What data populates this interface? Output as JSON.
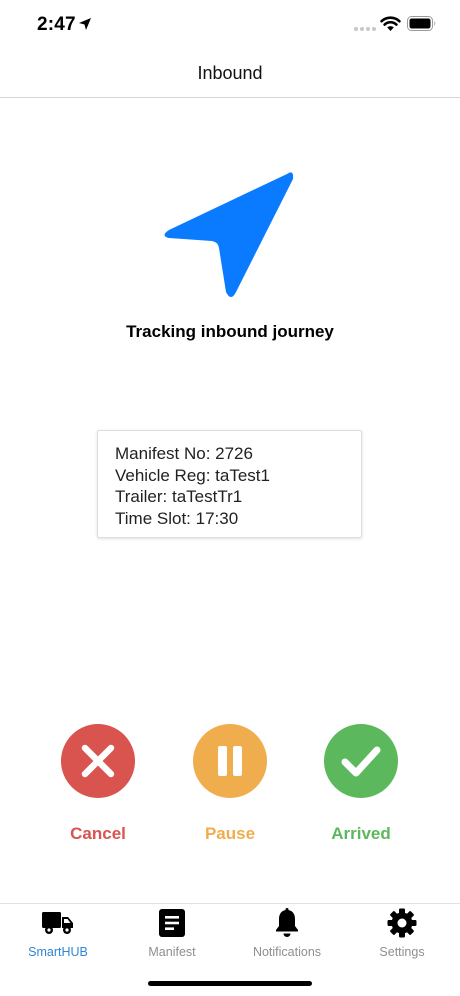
{
  "status_bar": {
    "time": "2:47",
    "icons": [
      "location-arrow-icon",
      "signal-icon",
      "wifi-icon",
      "battery-icon"
    ]
  },
  "header": {
    "title": "Inbound"
  },
  "journey": {
    "icon": "navigation-arrow-icon",
    "status_text": "Tracking inbound journey"
  },
  "manifest_card": {
    "lines": [
      "Manifest No: 2726",
      "Vehicle Reg: taTest1",
      "Trailer: taTestTr1",
      "Time Slot: 17:30"
    ]
  },
  "actions": {
    "cancel": {
      "label": "Cancel",
      "icon": "close-icon",
      "color": "#d9534f"
    },
    "pause": {
      "label": "Pause",
      "icon": "pause-icon",
      "color": "#f0ad4e"
    },
    "arrived": {
      "label": "Arrived",
      "icon": "check-icon",
      "color": "#5cb85c"
    }
  },
  "tabs": [
    {
      "label": "SmartHUB",
      "icon": "truck-icon",
      "active": true
    },
    {
      "label": "Manifest",
      "icon": "document-icon",
      "active": false
    },
    {
      "label": "Notifications",
      "icon": "bell-icon",
      "active": false
    },
    {
      "label": "Settings",
      "icon": "gear-icon",
      "active": false
    }
  ],
  "colors": {
    "accent_blue": "#0a7aff",
    "tab_active": "#2e86d6",
    "tab_inactive": "#8e8e93"
  }
}
